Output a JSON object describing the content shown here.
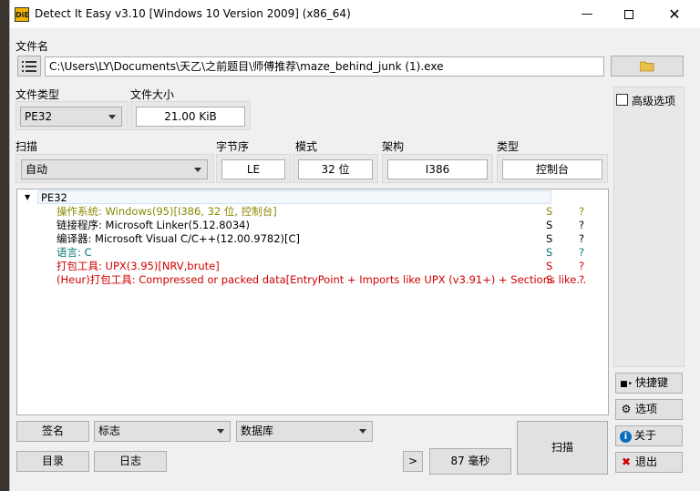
{
  "window": {
    "title": "Detect It Easy v3.10 [Windows 10 Version 2009] (x86_64)",
    "icon_label": "DiE"
  },
  "file": {
    "label": "文件名",
    "path": "C:\\Users\\LY\\Documents\\天乙\\之前题目\\师傅推荐\\maze_behind_junk (1).exe"
  },
  "file_type": {
    "label": "文件类型",
    "value": "PE32"
  },
  "file_size": {
    "label": "文件大小",
    "value": "21.00 KiB"
  },
  "scan": {
    "label": "扫描",
    "value": "自动"
  },
  "endianness": {
    "label": "字节序",
    "value": "LE"
  },
  "mode": {
    "label": "模式",
    "value": "32 位"
  },
  "arch": {
    "label": "架构",
    "value": "I386"
  },
  "type": {
    "label": "类型",
    "value": "控制台"
  },
  "advanced": {
    "label": "高级选项",
    "checked": false
  },
  "results": {
    "root": "PE32",
    "rows": [
      {
        "text": "操作系统: Windows(95)[I386, 32 位, 控制台]",
        "s": "S",
        "q": "?",
        "color": "#8a8a00"
      },
      {
        "text": "链接程序: Microsoft Linker(5.12.8034)",
        "s": "S",
        "q": "?",
        "color": "#000000"
      },
      {
        "text": "编译器: Microsoft Visual C/C++(12.00.9782)[C]",
        "s": "S",
        "q": "?",
        "color": "#000000"
      },
      {
        "text": "语言: C",
        "s": "S",
        "q": "?",
        "color": "#007878"
      },
      {
        "text": "打包工具: UPX(3.95)[NRV,brute]",
        "s": "S",
        "q": "?",
        "color": "#d00000"
      },
      {
        "text": "(Heur)打包工具: Compressed or packed data[EntryPoint + Imports like UPX (v3.91+) + Sections like...",
        "s": "S",
        "q": "?",
        "color": "#d00000"
      }
    ]
  },
  "side": {
    "shortcuts": "快捷键",
    "options": "选项",
    "about": "关于",
    "exit": "退出"
  },
  "bottom": {
    "signature": "签名",
    "flags": "标志",
    "database": "数据库",
    "directory": "目录",
    "log": "日志",
    "more": ">",
    "time": "87 毫秒",
    "scan": "扫描"
  },
  "colors": {
    "accent_blue": "#0a6ebd",
    "exit_red": "#d00000"
  }
}
